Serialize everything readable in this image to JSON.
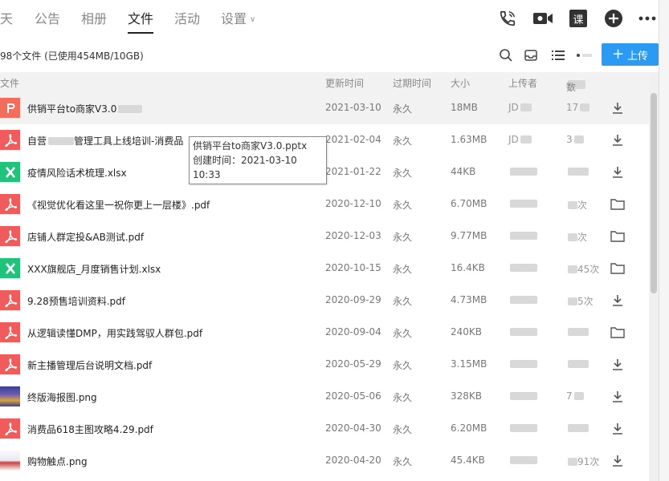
{
  "nav": {
    "tabs": [
      {
        "label": "天"
      },
      {
        "label": "公告"
      },
      {
        "label": "相册"
      },
      {
        "label": "文件"
      },
      {
        "label": "活动"
      },
      {
        "label": "设置"
      }
    ],
    "settings_chevron": "∨",
    "icons": [
      "phone-icon",
      "video-call-icon",
      "lesson-icon",
      "add-icon",
      "more-icon"
    ],
    "lesson_label": "课"
  },
  "toolbar": {
    "summary": "98个文件 (已使用454MB/10GB)",
    "upload_label": "上传"
  },
  "table": {
    "headers": {
      "name": "文件",
      "updated": "更新时间",
      "expire": "过期时间",
      "size": "大小",
      "uploader": "上传者",
      "downloads_a": "下",
      "downloads_b": "数"
    },
    "rows": [
      {
        "name": "供销平台to商家V3.0",
        "type": "ppt",
        "updated": "2021-03-10",
        "expire": "永久",
        "size": "18MB",
        "uploader": "JD",
        "downloads": "17",
        "action": "download"
      },
      {
        "name": "自营",
        "name_tail": "管理工具上线培训-消费品",
        "type": "pdf",
        "updated": "2021-02-04",
        "expire": "永久",
        "size": "1.63MB",
        "uploader": "JD",
        "downloads": "3",
        "action": "download"
      },
      {
        "name": "疫情风险话术梳理.xlsx",
        "type": "xls",
        "updated": "2021-01-22",
        "expire": "永久",
        "size": "44KB",
        "uploader": "",
        "downloads": "",
        "action": "download"
      },
      {
        "name": "《视觉优化看这里一祝你更上一层楼》.pdf",
        "type": "pdf",
        "updated": "2020-12-10",
        "expire": "永久",
        "size": "6.70MB",
        "uploader": "",
        "downloads": "次",
        "action": "folder"
      },
      {
        "name": "店铺人群定投&AB测试.pdf",
        "type": "pdf",
        "updated": "2020-12-03",
        "expire": "永久",
        "size": "9.77MB",
        "uploader": "",
        "downloads": "次",
        "action": "folder"
      },
      {
        "name": "XXX旗舰店_月度销售计划.xlsx",
        "type": "xls",
        "updated": "2020-10-15",
        "expire": "永久",
        "size": "16.4KB",
        "uploader": "",
        "downloads": "45次",
        "action": "folder"
      },
      {
        "name": "9.28预售培训资料.pdf",
        "type": "pdf",
        "updated": "2020-09-29",
        "expire": "永久",
        "size": "4.73MB",
        "uploader": "",
        "downloads": "5次",
        "action": "download"
      },
      {
        "name": "从逻辑读懂DMP，用实践驾驭人群包.pdf",
        "type": "pdf",
        "updated": "2020-09-04",
        "expire": "永久",
        "size": "240KB",
        "uploader": "",
        "downloads": "",
        "action": "folder"
      },
      {
        "name": "新主播管理后台说明文档.pdf",
        "type": "pdf",
        "updated": "2020-05-29",
        "expire": "永久",
        "size": "3.15MB",
        "uploader": "",
        "downloads": "",
        "action": "download"
      },
      {
        "name": "终版海报图.png",
        "type": "png",
        "updated": "2020-05-06",
        "expire": "永久",
        "size": "328KB",
        "uploader": "",
        "downloads": "7",
        "action": "download"
      },
      {
        "name": "消费品618主图攻略4.29.pdf",
        "type": "pdf",
        "updated": "2020-04-30",
        "expire": "永久",
        "size": "6.20MB",
        "uploader": "",
        "downloads": "",
        "action": "download"
      },
      {
        "name": "购物触点.png",
        "type": "png2",
        "updated": "2020-04-20",
        "expire": "永久",
        "size": "45.4KB",
        "uploader": "",
        "downloads": "91次",
        "action": "download"
      }
    ]
  },
  "tooltip": {
    "line1": "供销平台to商家V3.0.pptx",
    "line2": "创建时间：2021-03-10 10:33"
  },
  "colors": {
    "accent": "#2b9af3",
    "pdf": "#f05b5b",
    "xls": "#1fc37a"
  }
}
